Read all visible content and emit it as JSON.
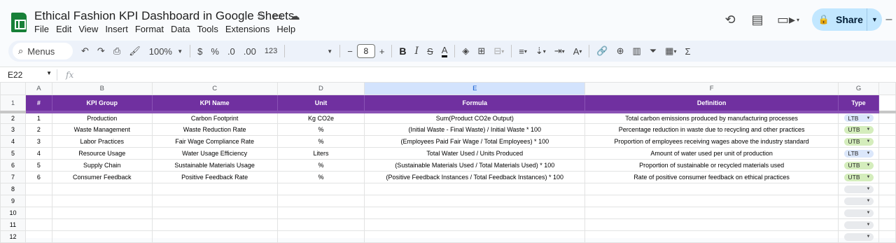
{
  "app": {
    "title": "Ethical Fashion KPI Dashboard in Google Sheets",
    "menu": [
      "File",
      "Edit",
      "View",
      "Insert",
      "Format",
      "Data",
      "Tools",
      "Extensions",
      "Help"
    ],
    "share_label": "Share"
  },
  "toolbar": {
    "menus_label": "Menus",
    "zoom": "100%",
    "currency": "$",
    "percent": "%",
    "dec_decrease": ".0",
    "dec_increase": ".00",
    "number_format": "123",
    "font_size": "8",
    "minus": "−",
    "plus": "+",
    "bold": "B",
    "italic": "I",
    "strike": "S",
    "text_color": "A",
    "sigma": "Σ"
  },
  "formula_bar": {
    "cell_ref": "E22",
    "fx": "fx"
  },
  "grid": {
    "columns": [
      "A",
      "B",
      "C",
      "D",
      "E",
      "F",
      "G"
    ],
    "headers": [
      "#",
      "KPI Group",
      "KPI Name",
      "Unit",
      "Formula",
      "Definition",
      "Type"
    ],
    "rows": [
      {
        "num": "2",
        "id": "1",
        "group": "Production",
        "name": "Carbon Footprint",
        "unit": "Kg CO2e",
        "formula": "Sum(Product CO2e Output)",
        "definition": "Total carbon emissions produced by manufacturing processes",
        "type": "LTB"
      },
      {
        "num": "3",
        "id": "2",
        "group": "Waste Management",
        "name": "Waste Reduction Rate",
        "unit": "%",
        "formula": "(Initial Waste - Final Waste) / Initial Waste * 100",
        "definition": "Percentage reduction in waste due to recycling and other practices",
        "type": "UTB"
      },
      {
        "num": "4",
        "id": "3",
        "group": "Labor Practices",
        "name": "Fair Wage Compliance Rate",
        "unit": "%",
        "formula": "(Employees Paid Fair Wage / Total Employees) * 100",
        "definition": "Proportion of employees receiving wages above the industry standard",
        "type": "UTB"
      },
      {
        "num": "5",
        "id": "4",
        "group": "Resource Usage",
        "name": "Water Usage Efficiency",
        "unit": "Liters",
        "formula": "Total Water Used / Units Produced",
        "definition": "Amount of water used per unit of production",
        "type": "LTB"
      },
      {
        "num": "6",
        "id": "5",
        "group": "Supply Chain",
        "name": "Sustainable Materials Usage",
        "unit": "%",
        "formula": "(Sustainable Materials Used / Total Materials Used) * 100",
        "definition": "Proportion of sustainable or recycled materials used",
        "type": "UTB"
      },
      {
        "num": "7",
        "id": "6",
        "group": "Consumer Feedback",
        "name": "Positive Feedback Rate",
        "unit": "%",
        "formula": "(Positive Feedback Instances / Total Feedback Instances) * 100",
        "definition": "Rate of positive consumer feedback on ethical practices",
        "type": "UTB"
      }
    ],
    "empty_rows": [
      "8",
      "9",
      "10",
      "11",
      "12"
    ],
    "header_row_num": "1"
  },
  "colors": {
    "header_purple": "#7030a0",
    "ltb_chip": "#dbe7fb",
    "utb_chip": "#d4edbc",
    "share_bg": "#c2e7ff"
  }
}
